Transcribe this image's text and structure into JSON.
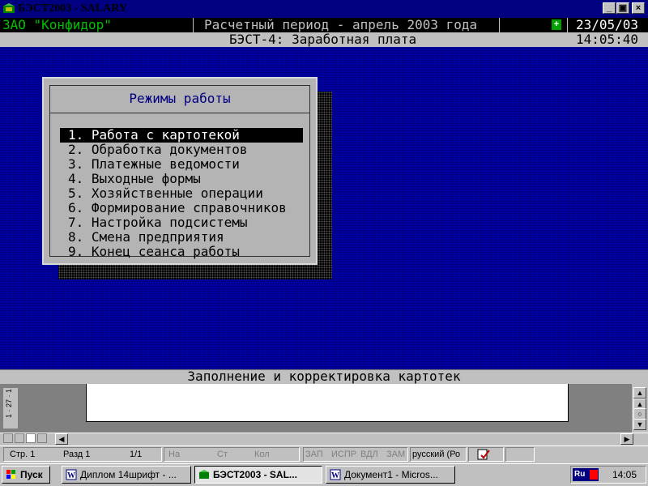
{
  "window": {
    "title": "БЭСТ2003 - SALARY",
    "buttons": {
      "minimize": "_",
      "restore": "▣",
      "close": "×"
    }
  },
  "header": {
    "company": "ЗАО \"Конфидор\"",
    "period": "Расчетный период - апрель 2003 года",
    "indicator": "+",
    "date": "23/05/03",
    "subsystem": "БЭСТ-4: Заработная плата",
    "time": "14:05:40"
  },
  "menu": {
    "title": "Режимы работы",
    "selected_index": 0,
    "items": [
      "1. Работа с картотекой",
      "2. Обработка документов",
      "3. Платежные ведомости",
      "4. Выходные формы",
      "5. Хозяйственные операции",
      "6. Формирование справочников",
      "7. Настройка подсистемы",
      "8. Смена предприятия",
      "9. Конец сеанса работы"
    ]
  },
  "status_line": "Заполнение и корректировка картотек",
  "word": {
    "ruler_text": "1 · 27 · 1",
    "status": {
      "page": "Стр. 1",
      "section": "Разд 1",
      "pages": "1/1",
      "at": "На",
      "line": "Ст",
      "col": "Кол",
      "rec": "ЗАП",
      "trk": "ИСПР",
      "ext": "ВДЛ",
      "ovr": "ЗАМ",
      "language": "русский (Ро"
    }
  },
  "taskbar": {
    "start": "Пуск",
    "buttons": [
      {
        "label": "Диплом 14шрифт - ...",
        "icon": "word-icon",
        "active": false
      },
      {
        "label": "БЭСТ2003 - SAL...",
        "icon": "app-icon",
        "active": true
      },
      {
        "label": "Документ1 - Micros...",
        "icon": "word-icon",
        "active": false
      }
    ],
    "lang": "Ru",
    "clock": "14:05"
  },
  "colors": {
    "title_bar": "#000080",
    "workspace": "#0000a8",
    "company_text": "#00c000",
    "menu_title": "#000080",
    "menu_bg": "#b4b4b4"
  }
}
